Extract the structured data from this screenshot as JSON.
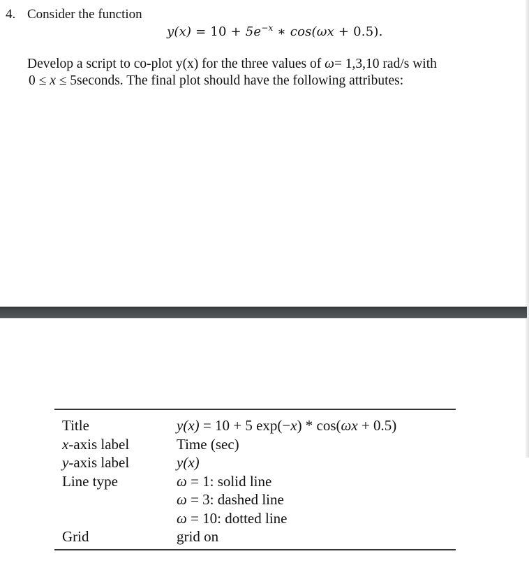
{
  "question": {
    "number": "4.",
    "intro": "Consider the function",
    "equation": {
      "lhs": "y(x)",
      "equals": " = ",
      "term1": "10",
      "plus": " + ",
      "coef": "5e",
      "exponent": "−x",
      "times": " ∗ ",
      "func": "cos(ωx",
      "tail": " + 0.5)."
    },
    "paragraph": {
      "line1_before": "Develop a script to co-plot y(x) for the three values of ",
      "line1_omega": "ω",
      "line1_after": "= 1,3,10 rad/s with",
      "line2_pre": "0 ≤ ",
      "line2_var": "x",
      "line2_post": " ≤ 5seconds. The final plot should have the following attributes:"
    }
  },
  "attributes_table": {
    "rows": [
      {
        "label_pre": "",
        "label_it": "",
        "label_post": "Title",
        "value": "y(x) = 10 + 5 exp(−x) * cos(ωx + 0.5)"
      },
      {
        "label_pre": "",
        "label_it": "x",
        "label_post": "-axis label",
        "value": "Time (sec)"
      },
      {
        "label_pre": "",
        "label_it": "y",
        "label_post": "-axis label",
        "value": "y(x)"
      },
      {
        "label_pre": "",
        "label_it": "",
        "label_post": "Line type",
        "value": "ω = 1: solid line"
      },
      {
        "label_pre": "",
        "label_it": "",
        "label_post": "",
        "value": "ω = 3: dashed line"
      },
      {
        "label_pre": "",
        "label_it": "",
        "label_post": "",
        "value": "ω = 10: dotted line"
      },
      {
        "label_pre": "",
        "label_it": "",
        "label_post": "Grid",
        "value": "grid on"
      }
    ],
    "title_value_parts": {
      "lhs": "y(x)",
      "rest": " = 10 + 5 exp(−",
      "x": "x",
      "mid": ") * cos(",
      "omega_x": "ωx",
      "end": " + 0.5)"
    },
    "yaxis_value_it": "y(x)",
    "line_types": [
      {
        "omega": "ω",
        "eq": " = ",
        "n": "1",
        "desc": ": solid line"
      },
      {
        "omega": "ω",
        "eq": " = ",
        "n": "3",
        "desc": ": dashed line"
      },
      {
        "omega": "ω",
        "eq": " = ",
        "n": "10",
        "desc": ": dotted line"
      }
    ]
  }
}
